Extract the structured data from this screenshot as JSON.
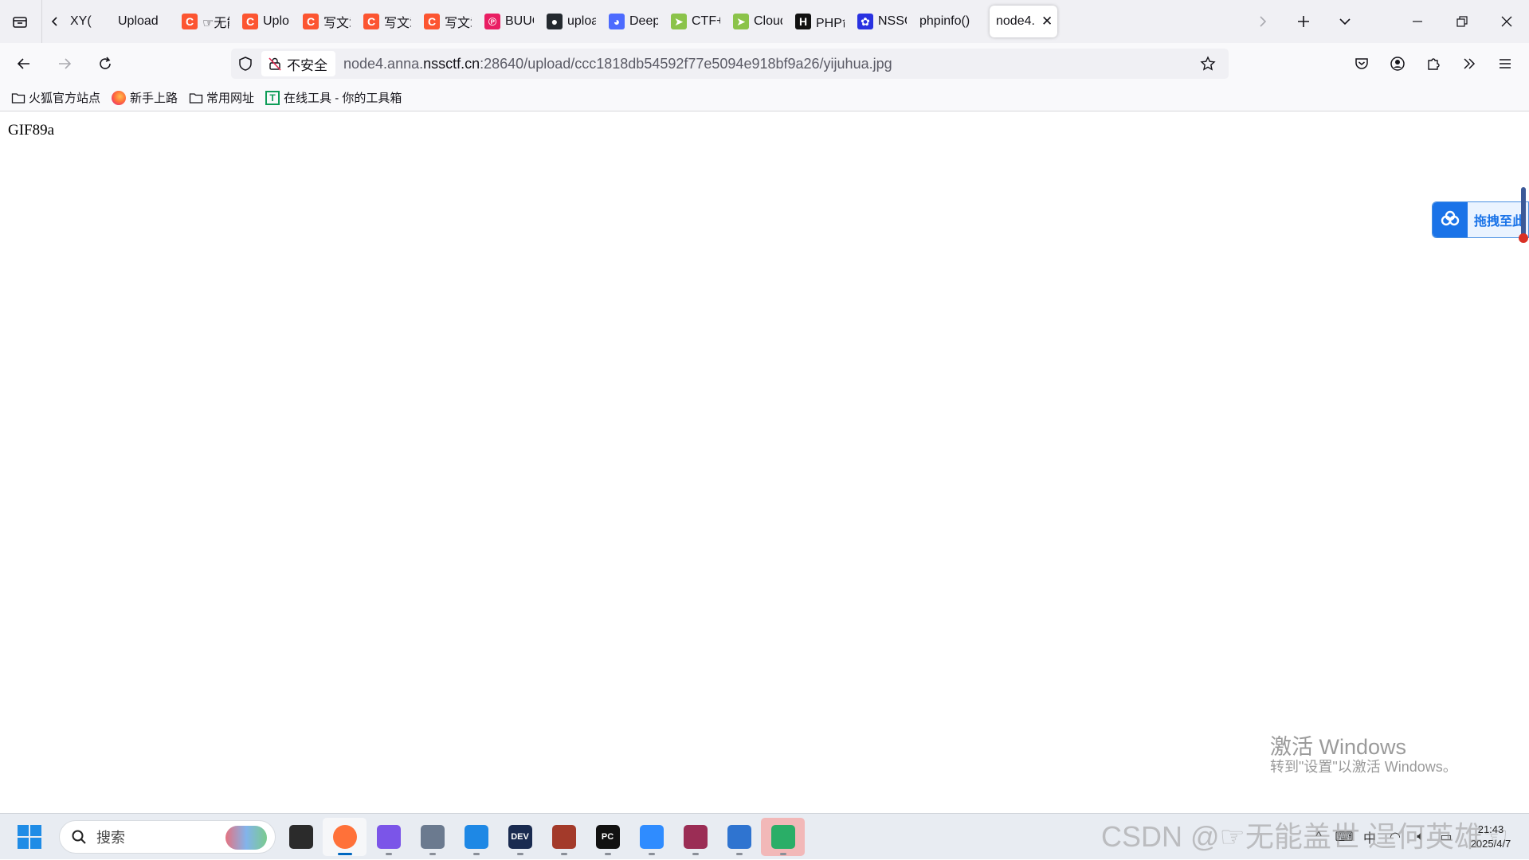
{
  "tabstrip": {
    "tabs": [
      {
        "title": "XY(",
        "favicon": "none",
        "favicon_color": "#f0f0f4"
      },
      {
        "title": "Upload",
        "favicon": "none",
        "favicon_color": "#f0f0f4"
      },
      {
        "title": "☞无能",
        "favicon": "csdn-c",
        "favicon_color": "#fc5531"
      },
      {
        "title": "Uplo",
        "favicon": "csdn-c",
        "favicon_color": "#fc5531"
      },
      {
        "title": "写文章",
        "favicon": "csdn-c",
        "favicon_color": "#fc5531"
      },
      {
        "title": "写文章",
        "favicon": "csdn-c",
        "favicon_color": "#fc5531"
      },
      {
        "title": "写文章",
        "favicon": "csdn-c",
        "favicon_color": "#fc5531"
      },
      {
        "title": "BUUC",
        "favicon": "buuctf-logo",
        "favicon_color": "#e91e63"
      },
      {
        "title": "uploa",
        "favicon": "github-logo",
        "favicon_color": "#24292f"
      },
      {
        "title": "Deep",
        "favicon": "deepseek-logo",
        "favicon_color": "#4d6bfe"
      },
      {
        "title": "CTF+",
        "favicon": "ctf-logo",
        "favicon_color": "#8bc34a"
      },
      {
        "title": "Cloud",
        "favicon": "ctf-logo",
        "favicon_color": "#8bc34a"
      },
      {
        "title": "PHP命",
        "favicon": "h-logo",
        "favicon_color": "#111111"
      },
      {
        "title": "NSSC",
        "favicon": "paw-logo",
        "favicon_color": "#2932e1"
      },
      {
        "title": "phpinfo()",
        "favicon": "none",
        "favicon_color": "#f0f0f4"
      }
    ],
    "active_tab": {
      "title": "node4.",
      "close": "✕"
    }
  },
  "navbar": {
    "security_label": "不安全",
    "url_prefix": "node4.anna.",
    "url_domain": "nssctf.cn",
    "url_suffix": ":28640/upload/ccc1818db54592f77e5094e918bf9a26/yijuhua.jpg"
  },
  "bookmarks": [
    {
      "label": "火狐官方站点",
      "icon": "folder-icon"
    },
    {
      "label": "新手上路",
      "icon": "firefox-icon"
    },
    {
      "label": "常用网址",
      "icon": "folder-icon"
    },
    {
      "label": "在线工具 - 你的工具箱",
      "icon": "tool-icon"
    }
  ],
  "content": {
    "text": "GIF89a",
    "drag_widget_label": "拖拽至此"
  },
  "watermark": {
    "title": "激活 Windows",
    "subtitle": "转到\"设置\"以激活 Windows。"
  },
  "taskbar": {
    "search_placeholder": "搜索",
    "apps": [
      {
        "name": "explorer-app",
        "color": "#2b2b2b",
        "label": ""
      },
      {
        "name": "firefox-app",
        "color": "#ff7139",
        "label": ""
      },
      {
        "name": "visual-studio-app",
        "color": "#7b55e8",
        "label": ""
      },
      {
        "name": "tool-app",
        "color": "#6b7a8f",
        "label": ""
      },
      {
        "name": "vmware-app",
        "color": "#1e88e5",
        "label": ""
      },
      {
        "name": "devc-app",
        "color": "#1a2b50",
        "label": "DEV"
      },
      {
        "name": "avatar-app",
        "color": "#a33a2a",
        "label": ""
      },
      {
        "name": "pycharm-app",
        "color": "#111111",
        "label": "PC"
      },
      {
        "name": "baidu-netdisk-app",
        "color": "#2f8cff",
        "label": ""
      },
      {
        "name": "winrar-app",
        "color": "#9b2d55",
        "label": ""
      },
      {
        "name": "notepad-app",
        "color": "#2f74d0",
        "label": ""
      },
      {
        "name": "wechat-app",
        "color": "#2aae67",
        "label": ""
      }
    ],
    "clock_time": "21:43",
    "clock_date": "2025/4/7",
    "watermark_csdn": "CSDN @☞无能盖世 逞何英雄☜"
  }
}
